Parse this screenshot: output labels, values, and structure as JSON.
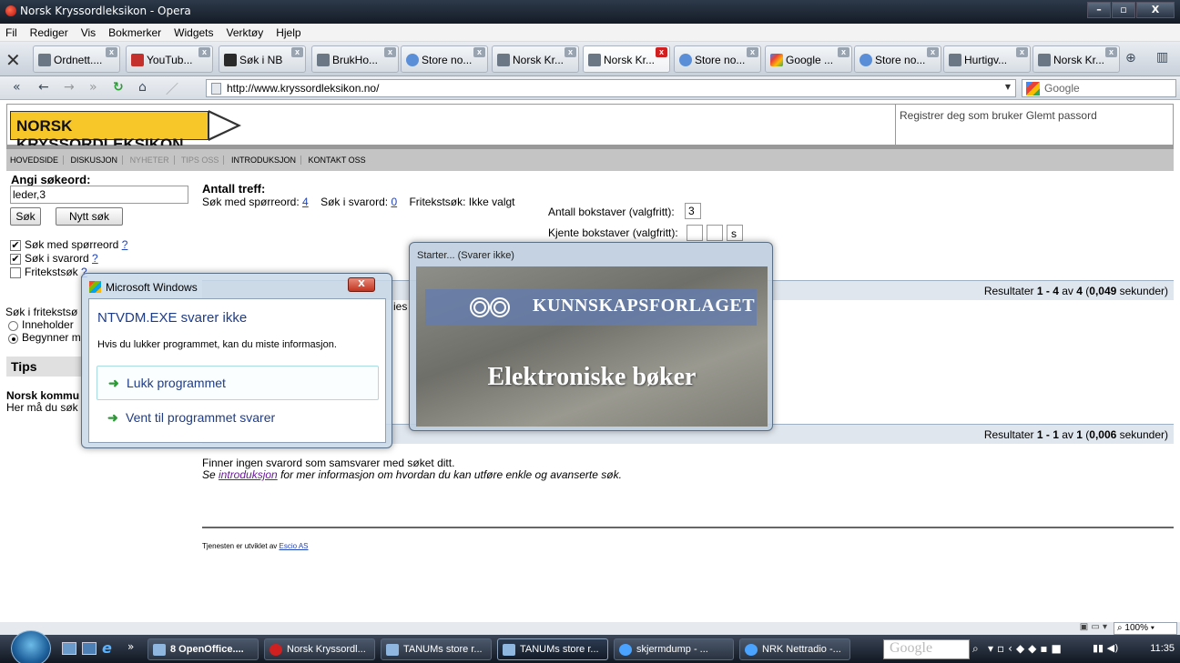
{
  "window": {
    "title": "Norsk Kryssordleksikon - Opera"
  },
  "menu": [
    "Fil",
    "Rediger",
    "Vis",
    "Bokmerker",
    "Widgets",
    "Verktøy",
    "Hjelp"
  ],
  "tabs": [
    "Ordnett....",
    "YouTub...",
    "Søk i NB",
    "BrukHo...",
    "Store no...",
    "Norsk Kr...",
    "Norsk Kr...",
    "Store no...",
    "Google ...",
    "Store no...",
    "Hurtigv...",
    "Norsk Kr..."
  ],
  "address": {
    "url": "http://www.kryssordleksikon.no/",
    "search_placeholder": "Google"
  },
  "site": {
    "logo": "NORSK KRYSSORDLEKSIKON",
    "user_links": "Registrer deg som bruker Glemt passord",
    "nav": [
      "HOVEDSIDE",
      "DISKUSJON",
      "NYHETER",
      "TIPS OSS",
      "INTRODUKSJON",
      "KONTAKT OSS"
    ]
  },
  "search": {
    "heading": "Angi søkeord:",
    "value": "leder,3",
    "search_btn": "Søk",
    "new_btn": "Nytt søk",
    "opt1": "Søk med spørreord",
    "opt2": "Søk i svarord",
    "opt3": "Fritekstsøk",
    "help": "?",
    "fritekst_label": "Søk i fritekstsø",
    "radio1": "Inneholder",
    "radio2": "Begynner m"
  },
  "tips": {
    "heading": "Tips",
    "line1": "Norsk kommu",
    "line2": "Her må du søk"
  },
  "hits": {
    "heading": "Antall treff:",
    "q_label": "Søk med spørreord:",
    "q_count": "4",
    "a_label": "Søk i svarord:",
    "a_count": "0",
    "free_label": "Fritekstsøk: Ikke valgt",
    "letters_label": "Antall bokstaver (valgfritt):",
    "letters_value": "3",
    "known_label": "Kjente bokstaver (valgfritt):",
    "known_values": [
      "",
      "",
      "s"
    ]
  },
  "results1": {
    "prefix": "Resultater ",
    "range": "1 - 4",
    "av": " av ",
    "total": "4",
    "time": "0,049",
    "suffix": " sekunder)"
  },
  "results2": {
    "prefix": "Resultater ",
    "range": "1 - 1",
    "av": " av ",
    "total": "1",
    "time": "0,006",
    "suffix": " sekunder)"
  },
  "partial": "ies",
  "no_results": {
    "line1": "Finner ingen svarord som samsvarer med søket ditt.",
    "line2_pre": "Se ",
    "line2_link": "introduksjon",
    "line2_post": " for mer informasjon om hvordan du kan utføre enkle og avanserte søk."
  },
  "footer": {
    "text": "Tjenesten er utviklet av ",
    "link": "Escio AS"
  },
  "zoom": "100%",
  "dialog": {
    "title": "Microsoft Windows",
    "heading": "NTVDM.EXE svarer ikke",
    "message": "Hvis du lukker programmet, kan du miste informasjon.",
    "option1": "Lukk programmet",
    "option2": "Vent til programmet svarer"
  },
  "splash": {
    "title": "Starter... (Svarer ikke)",
    "brand": "KUNNSKAPSFORLAGET",
    "slogan": "Elektroniske bøker"
  },
  "taskbar": {
    "items": [
      "8 OpenOffice....",
      "Norsk Kryssordl...",
      "TANUMs store r...",
      "TANUMs store r...",
      "skjermdump - ...",
      "NRK Nettradio -..."
    ],
    "google": "Google",
    "clock": "11:35"
  }
}
